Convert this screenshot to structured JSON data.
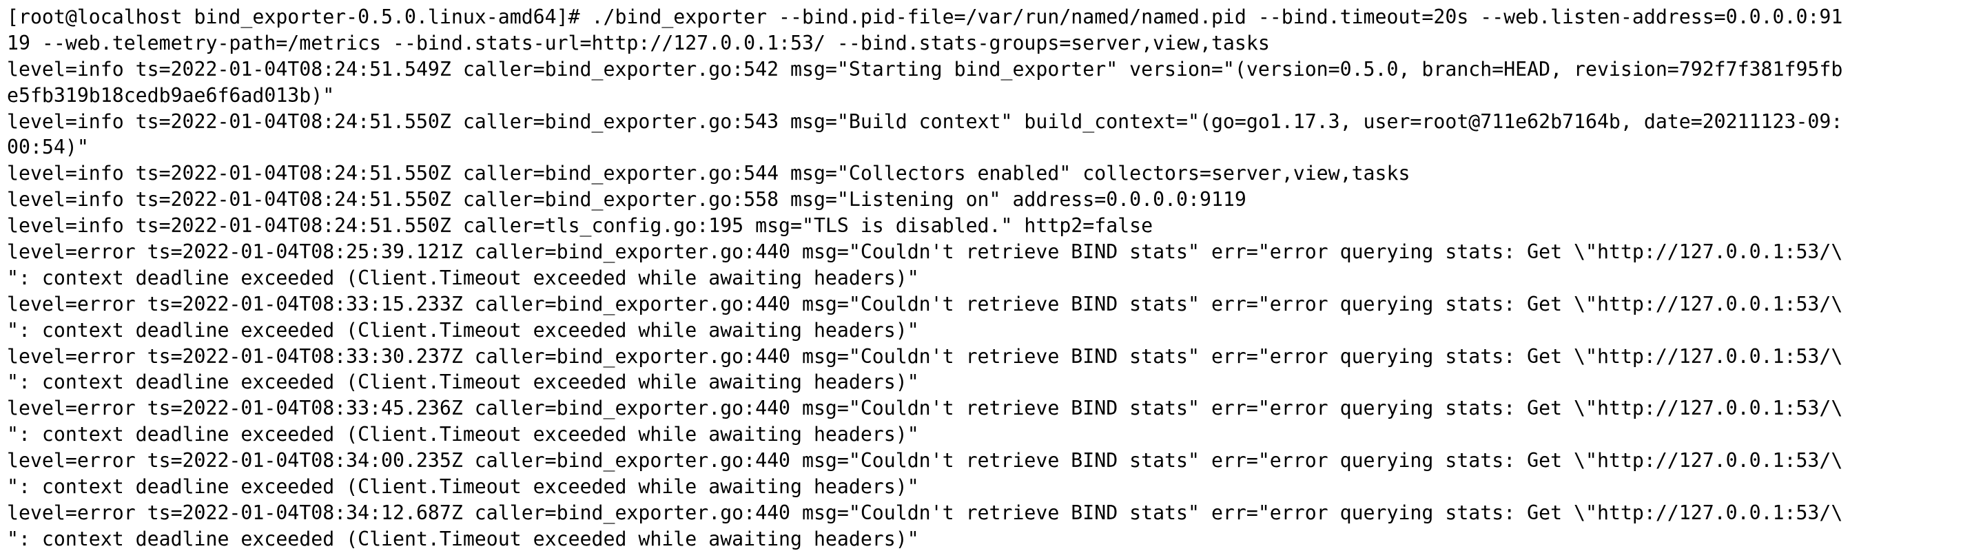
{
  "terminal": {
    "lines": [
      "[root@localhost bind_exporter-0.5.0.linux-amd64]# ./bind_exporter --bind.pid-file=/var/run/named/named.pid --bind.timeout=20s --web.listen-address=0.0.0.0:91",
      "19 --web.telemetry-path=/metrics --bind.stats-url=http://127.0.0.1:53/ --bind.stats-groups=server,view,tasks",
      "level=info ts=2022-01-04T08:24:51.549Z caller=bind_exporter.go:542 msg=\"Starting bind_exporter\" version=\"(version=0.5.0, branch=HEAD, revision=792f7f381f95fb",
      "e5fb319b18cedb9ae6f6ad013b)\"",
      "level=info ts=2022-01-04T08:24:51.550Z caller=bind_exporter.go:543 msg=\"Build context\" build_context=\"(go=go1.17.3, user=root@711e62b7164b, date=20211123-09:",
      "00:54)\"",
      "level=info ts=2022-01-04T08:24:51.550Z caller=bind_exporter.go:544 msg=\"Collectors enabled\" collectors=server,view,tasks",
      "level=info ts=2022-01-04T08:24:51.550Z caller=bind_exporter.go:558 msg=\"Listening on\" address=0.0.0.0:9119",
      "level=info ts=2022-01-04T08:24:51.550Z caller=tls_config.go:195 msg=\"TLS is disabled.\" http2=false",
      "level=error ts=2022-01-04T08:25:39.121Z caller=bind_exporter.go:440 msg=\"Couldn't retrieve BIND stats\" err=\"error querying stats: Get \\\"http://127.0.0.1:53/\\",
      "\": context deadline exceeded (Client.Timeout exceeded while awaiting headers)\"",
      "level=error ts=2022-01-04T08:33:15.233Z caller=bind_exporter.go:440 msg=\"Couldn't retrieve BIND stats\" err=\"error querying stats: Get \\\"http://127.0.0.1:53/\\",
      "\": context deadline exceeded (Client.Timeout exceeded while awaiting headers)\"",
      "level=error ts=2022-01-04T08:33:30.237Z caller=bind_exporter.go:440 msg=\"Couldn't retrieve BIND stats\" err=\"error querying stats: Get \\\"http://127.0.0.1:53/\\",
      "\": context deadline exceeded (Client.Timeout exceeded while awaiting headers)\"",
      "level=error ts=2022-01-04T08:33:45.236Z caller=bind_exporter.go:440 msg=\"Couldn't retrieve BIND stats\" err=\"error querying stats: Get \\\"http://127.0.0.1:53/\\",
      "\": context deadline exceeded (Client.Timeout exceeded while awaiting headers)\"",
      "level=error ts=2022-01-04T08:34:00.235Z caller=bind_exporter.go:440 msg=\"Couldn't retrieve BIND stats\" err=\"error querying stats: Get \\\"http://127.0.0.1:53/\\",
      "\": context deadline exceeded (Client.Timeout exceeded while awaiting headers)\"",
      "level=error ts=2022-01-04T08:34:12.687Z caller=bind_exporter.go:440 msg=\"Couldn't retrieve BIND stats\" err=\"error querying stats: Get \\\"http://127.0.0.1:53/\\",
      "\": context deadline exceeded (Client.Timeout exceeded while awaiting headers)\""
    ]
  },
  "colors": {
    "background": "#ffffff",
    "text": "#000000"
  }
}
